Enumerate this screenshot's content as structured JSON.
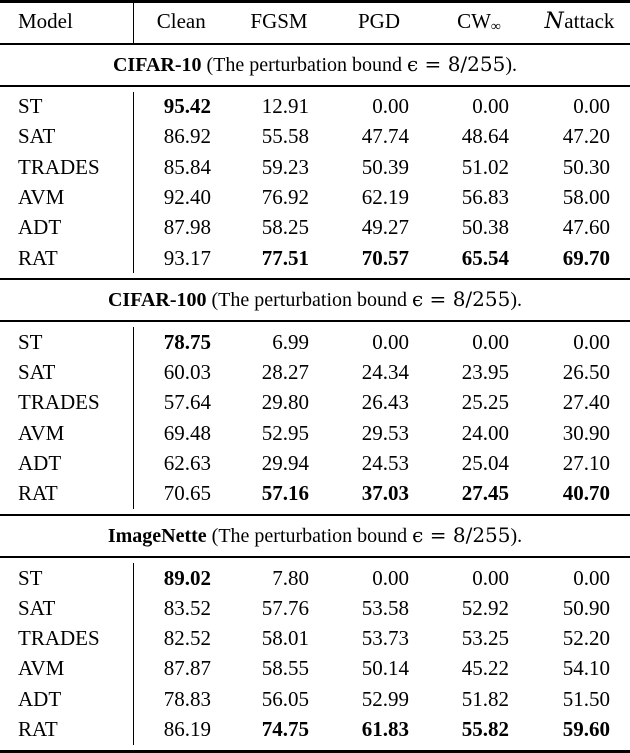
{
  "table": {
    "columns": [
      {
        "key": "model",
        "label": "Model"
      },
      {
        "key": "clean",
        "label": "Clean"
      },
      {
        "key": "fgsm",
        "label": "FGSM"
      },
      {
        "key": "pgd",
        "label": "PGD"
      },
      {
        "key": "cw",
        "label": "CW",
        "subscript": "∞"
      },
      {
        "key": "nattack",
        "label": "attack",
        "prefix": "N"
      }
    ],
    "sections": [
      {
        "id": "cifar10",
        "dataset": "CIFAR-10",
        "caption_pre": " (The perturbation bound ",
        "epsilon": "ϵ",
        "equals": " = ",
        "bound": "8/255",
        "caption_post": ").",
        "rows": [
          {
            "model": "ST",
            "clean": "95.42",
            "fgsm": "12.91",
            "pgd": "0.00",
            "cw": "0.00",
            "nattack": "0.00",
            "bold": {
              "clean": true,
              "fgsm": false,
              "pgd": false,
              "cw": false,
              "nattack": false
            }
          },
          {
            "model": "SAT",
            "clean": "86.92",
            "fgsm": "55.58",
            "pgd": "47.74",
            "cw": "48.64",
            "nattack": "47.20",
            "bold": {
              "clean": false,
              "fgsm": false,
              "pgd": false,
              "cw": false,
              "nattack": false
            }
          },
          {
            "model": "TRADES",
            "clean": "85.84",
            "fgsm": "59.23",
            "pgd": "50.39",
            "cw": "51.02",
            "nattack": "50.30",
            "bold": {
              "clean": false,
              "fgsm": false,
              "pgd": false,
              "cw": false,
              "nattack": false
            }
          },
          {
            "model": "AVM",
            "clean": "92.40",
            "fgsm": "76.92",
            "pgd": "62.19",
            "cw": "56.83",
            "nattack": "58.00",
            "bold": {
              "clean": false,
              "fgsm": false,
              "pgd": false,
              "cw": false,
              "nattack": false
            }
          },
          {
            "model": "ADT",
            "clean": "87.98",
            "fgsm": "58.25",
            "pgd": "49.27",
            "cw": "50.38",
            "nattack": "47.60",
            "bold": {
              "clean": false,
              "fgsm": false,
              "pgd": false,
              "cw": false,
              "nattack": false
            }
          },
          {
            "model": "RAT",
            "clean": "93.17",
            "fgsm": "77.51",
            "pgd": "70.57",
            "cw": "65.54",
            "nattack": "69.70",
            "bold": {
              "clean": false,
              "fgsm": true,
              "pgd": true,
              "cw": true,
              "nattack": true
            }
          }
        ]
      },
      {
        "id": "cifar100",
        "dataset": "CIFAR-100",
        "caption_pre": " (The perturbation bound ",
        "epsilon": "ϵ",
        "equals": " = ",
        "bound": "8/255",
        "caption_post": ").",
        "rows": [
          {
            "model": "ST",
            "clean": "78.75",
            "fgsm": "6.99",
            "pgd": "0.00",
            "cw": "0.00",
            "nattack": "0.00",
            "bold": {
              "clean": true,
              "fgsm": false,
              "pgd": false,
              "cw": false,
              "nattack": false
            }
          },
          {
            "model": "SAT",
            "clean": "60.03",
            "fgsm": "28.27",
            "pgd": "24.34",
            "cw": "23.95",
            "nattack": "26.50",
            "bold": {
              "clean": false,
              "fgsm": false,
              "pgd": false,
              "cw": false,
              "nattack": false
            }
          },
          {
            "model": "TRADES",
            "clean": "57.64",
            "fgsm": "29.80",
            "pgd": "26.43",
            "cw": "25.25",
            "nattack": "27.40",
            "bold": {
              "clean": false,
              "fgsm": false,
              "pgd": false,
              "cw": false,
              "nattack": false
            }
          },
          {
            "model": "AVM",
            "clean": "69.48",
            "fgsm": "52.95",
            "pgd": "29.53",
            "cw": "24.00",
            "nattack": "30.90",
            "bold": {
              "clean": false,
              "fgsm": false,
              "pgd": false,
              "cw": false,
              "nattack": false
            }
          },
          {
            "model": "ADT",
            "clean": "62.63",
            "fgsm": "29.94",
            "pgd": "24.53",
            "cw": "25.04",
            "nattack": "27.10",
            "bold": {
              "clean": false,
              "fgsm": false,
              "pgd": false,
              "cw": false,
              "nattack": false
            }
          },
          {
            "model": "RAT",
            "clean": "70.65",
            "fgsm": "57.16",
            "pgd": "37.03",
            "cw": "27.45",
            "nattack": "40.70",
            "bold": {
              "clean": false,
              "fgsm": true,
              "pgd": true,
              "cw": true,
              "nattack": true
            }
          }
        ]
      },
      {
        "id": "imagenette",
        "dataset": "ImageNette",
        "caption_pre": " (The perturbation bound ",
        "epsilon": "ϵ",
        "equals": " = ",
        "bound": "8/255",
        "caption_post": ").",
        "rows": [
          {
            "model": "ST",
            "clean": "89.02",
            "fgsm": "7.80",
            "pgd": "0.00",
            "cw": "0.00",
            "nattack": "0.00",
            "bold": {
              "clean": true,
              "fgsm": false,
              "pgd": false,
              "cw": false,
              "nattack": false
            }
          },
          {
            "model": "SAT",
            "clean": "83.52",
            "fgsm": "57.76",
            "pgd": "53.58",
            "cw": "52.92",
            "nattack": "50.90",
            "bold": {
              "clean": false,
              "fgsm": false,
              "pgd": false,
              "cw": false,
              "nattack": false
            }
          },
          {
            "model": "TRADES",
            "clean": "82.52",
            "fgsm": "58.01",
            "pgd": "53.73",
            "cw": "53.25",
            "nattack": "52.20",
            "bold": {
              "clean": false,
              "fgsm": false,
              "pgd": false,
              "cw": false,
              "nattack": false
            }
          },
          {
            "model": "AVM",
            "clean": "87.87",
            "fgsm": "58.55",
            "pgd": "50.14",
            "cw": "45.22",
            "nattack": "54.10",
            "bold": {
              "clean": false,
              "fgsm": false,
              "pgd": false,
              "cw": false,
              "nattack": false
            }
          },
          {
            "model": "ADT",
            "clean": "78.83",
            "fgsm": "56.05",
            "pgd": "52.99",
            "cw": "51.82",
            "nattack": "51.50",
            "bold": {
              "clean": false,
              "fgsm": false,
              "pgd": false,
              "cw": false,
              "nattack": false
            }
          },
          {
            "model": "RAT",
            "clean": "86.19",
            "fgsm": "74.75",
            "pgd": "61.83",
            "cw": "55.82",
            "nattack": "59.60",
            "bold": {
              "clean": false,
              "fgsm": true,
              "pgd": true,
              "cw": true,
              "nattack": true
            }
          }
        ]
      }
    ]
  }
}
